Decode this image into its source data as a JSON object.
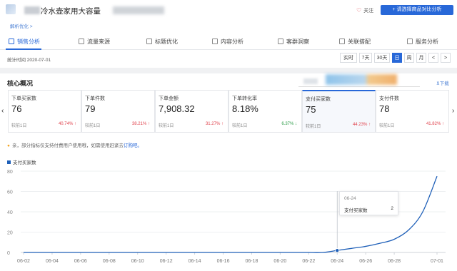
{
  "header": {
    "title": "冷水壶家用大容量",
    "breadcrumb": "解析优化 >",
    "follow_label": "关注",
    "compare_button": "+ 请选择商品对比分析"
  },
  "tabs": [
    {
      "label": "销售分析",
      "icon": "chart-icon",
      "active": true
    },
    {
      "label": "流量来源",
      "icon": "flow-icon",
      "active": false
    },
    {
      "label": "标题优化",
      "icon": "edit-icon",
      "active": false
    },
    {
      "label": "内容分析",
      "icon": "content-icon",
      "active": false
    },
    {
      "label": "客群洞察",
      "icon": "people-icon",
      "active": false
    },
    {
      "label": "关联搭配",
      "icon": "link-icon",
      "active": false
    },
    {
      "label": "服务分析",
      "icon": "service-icon",
      "active": false
    }
  ],
  "stat_time": "统计时间 2020-07-01",
  "time_ranges": [
    "实时",
    "7天",
    "30天",
    "日",
    "周",
    "月",
    "<",
    ">"
  ],
  "selected_range": "日",
  "core": {
    "title": "核心概况",
    "download": "⊻下载"
  },
  "metrics": [
    {
      "label": "下单买家数",
      "value": "76",
      "compare": "较前1日",
      "change": "40.74%",
      "direction": "up"
    },
    {
      "label": "下单件数",
      "value": "79",
      "compare": "较前1日",
      "change": "38.21%",
      "direction": "up"
    },
    {
      "label": "下单金额",
      "value": "7,908.32",
      "compare": "较前1日",
      "change": "31.27%",
      "direction": "up"
    },
    {
      "label": "下单转化率",
      "value": "8.18%",
      "compare": "较前1日",
      "change": "6.37%",
      "direction": "down"
    },
    {
      "label": "支付买家数",
      "value": "75",
      "compare": "较前1日",
      "change": "44.23%",
      "direction": "up",
      "selected": true
    },
    {
      "label": "支付件数",
      "value": "78",
      "compare": "较前1日",
      "change": "41.82%",
      "direction": "up"
    }
  ],
  "notice": {
    "text": "亲，部分指标仅支持付费用户使用哦，如需使用赶紧去",
    "link": "订购吧。"
  },
  "tooltip": {
    "date": "06-24",
    "label": "支付买家数",
    "value": "2"
  },
  "colors": {
    "accent": "#2868d8",
    "line": "#1e5fb8",
    "up": "#e0424c",
    "down": "#2b9b47"
  },
  "chart_data": {
    "type": "line",
    "ylim": [
      0,
      80
    ],
    "yticks": [
      0,
      20,
      40,
      60,
      80
    ],
    "xticks": [
      "06-02",
      "06-04",
      "06-06",
      "06-08",
      "06-10",
      "06-12",
      "06-14",
      "06-16",
      "06-18",
      "06-20",
      "06-22",
      "06-24",
      "06-26",
      "06-28",
      "07-01"
    ],
    "series": [
      {
        "name": "支付买家数",
        "x": [
          "06-02",
          "06-03",
          "06-04",
          "06-05",
          "06-06",
          "06-07",
          "06-08",
          "06-09",
          "06-10",
          "06-11",
          "06-12",
          "06-13",
          "06-14",
          "06-15",
          "06-16",
          "06-17",
          "06-18",
          "06-19",
          "06-20",
          "06-21",
          "06-22",
          "06-23",
          "06-24",
          "06-25",
          "06-26",
          "06-27",
          "06-28",
          "06-29",
          "06-30",
          "07-01"
        ],
        "values": [
          0,
          0,
          0,
          0,
          0,
          0,
          0,
          0,
          0,
          0,
          0,
          0,
          0,
          0,
          0,
          0,
          0,
          0,
          0,
          0,
          0,
          0,
          2,
          4,
          6,
          9,
          13,
          22,
          40,
          75
        ]
      }
    ],
    "highlight_index": 22
  }
}
